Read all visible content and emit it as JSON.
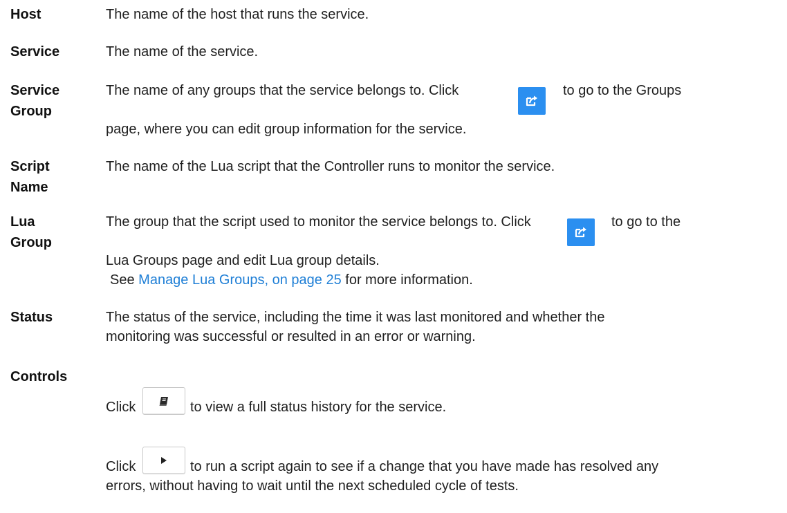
{
  "rows": {
    "host": {
      "term": "Host",
      "desc": "The name of the host that runs the service."
    },
    "service": {
      "term": "Service",
      "desc": "The name of the service."
    },
    "service_group": {
      "term_line1": "Service",
      "term_line2": "Group",
      "desc_before": "The name of any groups that the service belongs to. Click",
      "desc_after": "to go to the Groups",
      "desc_line2": "page, where you can edit group information for the service."
    },
    "script_name": {
      "term_line1": "Script",
      "term_line2": "Name",
      "desc": "The name of the Lua script that the Controller runs to monitor the service."
    },
    "lua_group": {
      "term_line1": "Lua",
      "term_line2": "Group",
      "desc_before": "The group that the script used to monitor the service belongs to. Click",
      "desc_after": "to go to the",
      "desc_line2": "Lua Groups page and edit Lua group details.",
      "see_prefix": "See",
      "link_text": "Manage Lua Groups, on page 25",
      "see_suffix": "for more information."
    },
    "status": {
      "term": "Status",
      "desc_line1": "The status of the service, including the time it was last monitored and whether the",
      "desc_line2": "monitoring was successful or resulted in an error or warning."
    },
    "controls": {
      "term": "Controls",
      "click1_prefix": "Click",
      "click1_suffix": "to view a full status history for the service.",
      "click2_prefix": "Click",
      "click2_suffix": "to run a script again to see if a change that you have made has resolved any",
      "click2_line2": "errors, without having to wait until the next scheduled cycle of tests."
    }
  },
  "icons": {
    "open_link": "open-link-icon",
    "history": "book-icon",
    "run": "play-icon"
  },
  "colors": {
    "link": "#1f7fd6",
    "blue_button": "#2b8ff0"
  }
}
